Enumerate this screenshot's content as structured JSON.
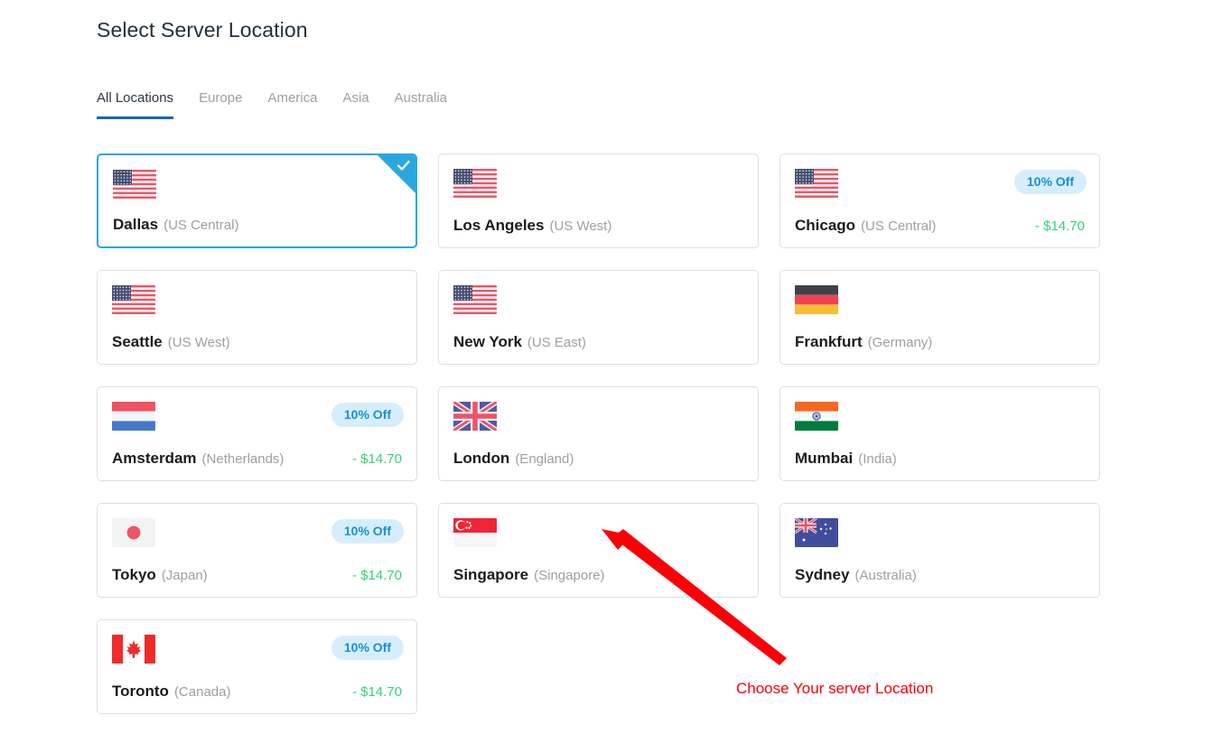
{
  "header": {
    "title": "Select Server Location"
  },
  "tabs": [
    {
      "label": "All Locations",
      "active": true
    },
    {
      "label": "Europe",
      "active": false
    },
    {
      "label": "America",
      "active": false
    },
    {
      "label": "Asia",
      "active": false
    },
    {
      "label": "Australia",
      "active": false
    }
  ],
  "locations": [
    {
      "city": "Dallas",
      "region": "(US Central)",
      "flag": "us",
      "selected": true,
      "badge": null,
      "price": null
    },
    {
      "city": "Los Angeles",
      "region": "(US West)",
      "flag": "us",
      "selected": false,
      "badge": null,
      "price": null
    },
    {
      "city": "Chicago",
      "region": "(US Central)",
      "flag": "us",
      "selected": false,
      "badge": "10% Off",
      "price": "- $14.70"
    },
    {
      "city": "Seattle",
      "region": "(US West)",
      "flag": "us",
      "selected": false,
      "badge": null,
      "price": null
    },
    {
      "city": "New York",
      "region": "(US East)",
      "flag": "us",
      "selected": false,
      "badge": null,
      "price": null
    },
    {
      "city": "Frankfurt",
      "region": "(Germany)",
      "flag": "de",
      "selected": false,
      "badge": null,
      "price": null
    },
    {
      "city": "Amsterdam",
      "region": "(Netherlands)",
      "flag": "nl",
      "selected": false,
      "badge": "10% Off",
      "price": "- $14.70"
    },
    {
      "city": "London",
      "region": "(England)",
      "flag": "gb",
      "selected": false,
      "badge": null,
      "price": null
    },
    {
      "city": "Mumbai",
      "region": "(India)",
      "flag": "in",
      "selected": false,
      "badge": null,
      "price": null
    },
    {
      "city": "Tokyo",
      "region": "(Japan)",
      "flag": "jp",
      "selected": false,
      "badge": "10% Off",
      "price": "- $14.70"
    },
    {
      "city": "Singapore",
      "region": "(Singapore)",
      "flag": "sg",
      "selected": false,
      "badge": null,
      "price": null
    },
    {
      "city": "Sydney",
      "region": "(Australia)",
      "flag": "au",
      "selected": false,
      "badge": null,
      "price": null
    },
    {
      "city": "Toronto",
      "region": "(Canada)",
      "flag": "ca",
      "selected": false,
      "badge": "10% Off",
      "price": "- $14.70"
    }
  ],
  "annotation": {
    "text": "Choose Your server Location",
    "color": "#fb0007"
  },
  "colors": {
    "accent_blue": "#29a8e0",
    "tab_underline": "#1569b0",
    "badge_bg": "#d6eefb",
    "badge_text": "#1a8fd6",
    "price_green": "#36d17a",
    "card_border": "#dcdfe3"
  }
}
